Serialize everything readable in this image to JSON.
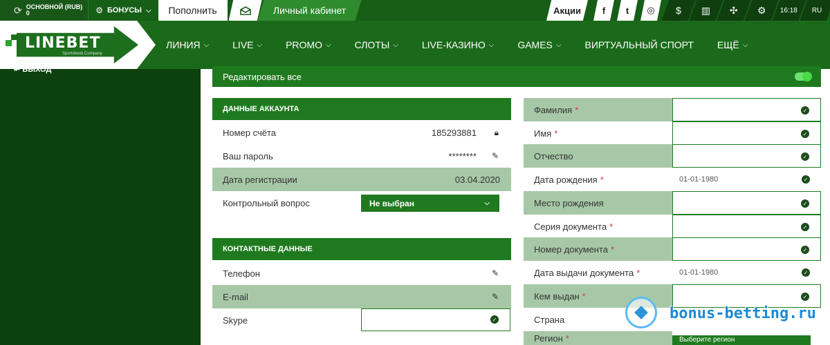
{
  "topbar": {
    "account_label": "ОСНОВНОЙ (RUB)",
    "account_balance": "0",
    "bonus_label": "БОНУСЫ",
    "deposit_label": "Пополнить",
    "cabinet_label": "Личный кабинет",
    "promo_label": "Акции",
    "social": [
      "f",
      "t",
      "◎"
    ],
    "time": "16:18",
    "lang": "RU"
  },
  "header": {
    "logo_text": "LINEBET",
    "logo_sub": "Sportsbook Company",
    "nav": [
      "ЛИНИЯ",
      "LIVE",
      "PROMO",
      "СЛОТЫ",
      "LIVE-КАЗИНО",
      "GAMES",
      "ВИРТУАЛЬНЫЙ СПОРТ",
      "ЕЩЁ"
    ]
  },
  "sidebar": {
    "logout_label": "ВЫХОД"
  },
  "main": {
    "edit_all": "Редактировать все",
    "account_section": {
      "title": "ДАННЫЕ АККАУНТА",
      "rows": [
        {
          "label": "Номер счёта",
          "value": "185293881"
        },
        {
          "label": "Ваш пароль",
          "value": "********"
        },
        {
          "label": "Дата регистрации",
          "value": "03.04.2020"
        },
        {
          "label": "Контрольный вопрос",
          "value": ""
        }
      ],
      "question_select": "Не выбран"
    },
    "contact_section": {
      "title": "КОНТАКТНЫЕ ДАННЫЕ",
      "rows": [
        {
          "label": "Телефон"
        },
        {
          "label": "E-mail"
        },
        {
          "label": "Skype"
        }
      ]
    },
    "personal": [
      {
        "label": "Фамилия",
        "required": "*",
        "value": ""
      },
      {
        "label": "Имя",
        "required": "*",
        "value": ""
      },
      {
        "label": "Отчество",
        "required": "",
        "value": ""
      },
      {
        "label": "Дата рождения",
        "required": "*",
        "value": "01-01-1980"
      },
      {
        "label": "Место рождения",
        "required": "",
        "value": ""
      },
      {
        "label": "Серия документа",
        "required": "*",
        "value": ""
      },
      {
        "label": "Номер документа",
        "required": "*",
        "value": ""
      },
      {
        "label": "Дата выдачи документа",
        "required": "*",
        "value": "01-01-1980"
      },
      {
        "label": "Кем выдан",
        "required": "*",
        "value": ""
      },
      {
        "label": "Страна",
        "required": "",
        "value": ""
      },
      {
        "label": "Регион",
        "required": "*",
        "value": ""
      }
    ],
    "region_select": "Выберите регион"
  },
  "watermark": {
    "text": "bonus-betting.ru"
  }
}
